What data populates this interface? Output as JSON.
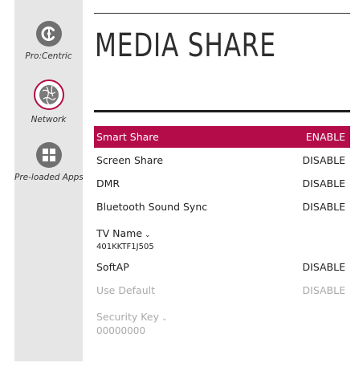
{
  "sidebar": {
    "items": [
      {
        "label": "Pro:Centric",
        "icon": "pro-centric-icon"
      },
      {
        "label": "Network",
        "icon": "network-globe-icon",
        "active": true
      },
      {
        "label": "Pre-loaded Apps",
        "icon": "apps-grid-icon"
      }
    ]
  },
  "page": {
    "title": "MEDIA SHARE"
  },
  "settings": [
    {
      "label": "Smart Share",
      "value": "ENABLE",
      "selected": true
    },
    {
      "label": "Screen Share",
      "value": "DISABLE"
    },
    {
      "label": "DMR",
      "value": "DISABLE"
    },
    {
      "label": "Bluetooth Sound Sync",
      "value": "DISABLE"
    },
    {
      "label": "TV Name",
      "value": "401KKTF1J505",
      "dropdown": true
    },
    {
      "label": "SoftAP",
      "value": "DISABLE"
    },
    {
      "label": "Use Default",
      "value": "DISABLE",
      "disabled": true
    },
    {
      "label": "Security Key",
      "value": "00000000",
      "dropdown": true,
      "disabled": true
    }
  ],
  "colors": {
    "accent": "#b40c48",
    "sidebar_bg": "#e6e6e6",
    "disabled_text": "#aaaaaa"
  }
}
